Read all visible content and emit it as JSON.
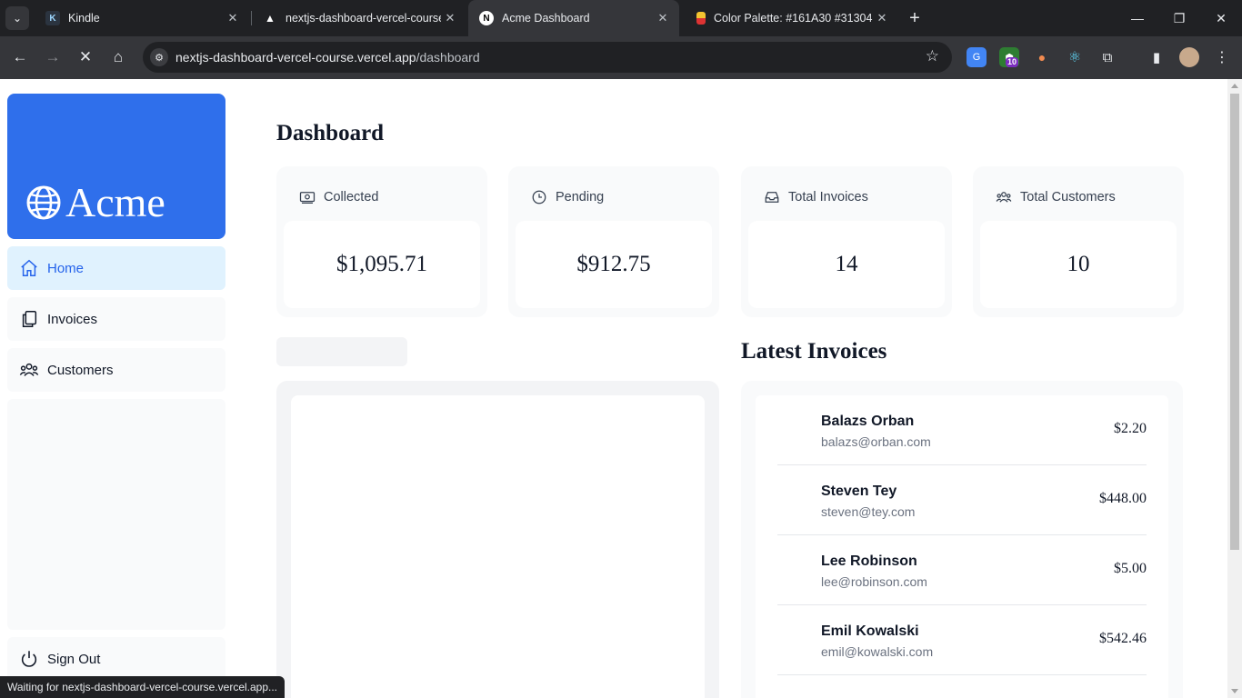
{
  "browser": {
    "tabs": [
      {
        "title": "Kindle",
        "favicon": "K"
      },
      {
        "title": "nextjs-dashboard-vercel-course",
        "favicon": "▲"
      },
      {
        "title": "Acme Dashboard",
        "favicon": "N"
      },
      {
        "title": "Color Palette: #161A30 #31304",
        "favicon": "■"
      }
    ],
    "url_host": "nextjs-dashboard-vercel-course.vercel.app",
    "url_path": "/dashboard",
    "extension_badge": "10",
    "status_text": "Waiting for nextjs-dashboard-vercel-course.vercel.app..."
  },
  "sidebar": {
    "brand": "Acme",
    "brand_color": "#2f6feb",
    "items": [
      {
        "label": "Home",
        "icon": "home-icon"
      },
      {
        "label": "Invoices",
        "icon": "document-duplicate-icon"
      },
      {
        "label": "Customers",
        "icon": "user-group-icon"
      }
    ],
    "sign_out": "Sign Out"
  },
  "main": {
    "title": "Dashboard",
    "cards": [
      {
        "label": "Collected",
        "value": "$1,095.71",
        "icon": "banknotes-icon"
      },
      {
        "label": "Pending",
        "value": "$912.75",
        "icon": "clock-icon"
      },
      {
        "label": "Total Invoices",
        "value": "14",
        "icon": "inbox-icon"
      },
      {
        "label": "Total Customers",
        "value": "10",
        "icon": "user-group-icon"
      }
    ],
    "latest_invoices_title": "Latest Invoices",
    "invoices": [
      {
        "name": "Balazs Orban",
        "email": "balazs@orban.com",
        "amount": "$2.20"
      },
      {
        "name": "Steven Tey",
        "email": "steven@tey.com",
        "amount": "$448.00"
      },
      {
        "name": "Lee Robinson",
        "email": "lee@robinson.com",
        "amount": "$5.00"
      },
      {
        "name": "Emil Kowalski",
        "email": "emil@kowalski.com",
        "amount": "$542.46"
      }
    ]
  }
}
